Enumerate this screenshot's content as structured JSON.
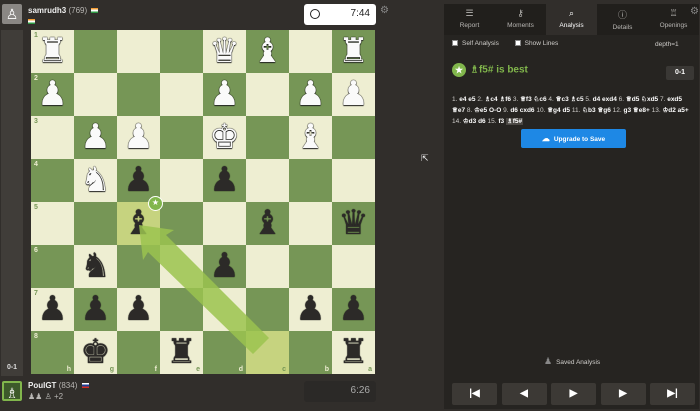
{
  "eval_bar": {
    "label": "0-1"
  },
  "top_player": {
    "avatar": "♙",
    "name": "samrudh3",
    "rating": "(769)"
  },
  "bottom_player": {
    "avatar": "♗",
    "name": "PoulGT",
    "rating": "(834)",
    "captured": "♟♟ ♙ +2"
  },
  "top_clock": {
    "icon": "clock-icon",
    "time": "7:44"
  },
  "bottom_clock": {
    "time": "6:26"
  },
  "board": {
    "ranks": [
      "1",
      "2",
      "3",
      "4",
      "5",
      "6",
      "7",
      "8"
    ],
    "files": [
      "h",
      "g",
      "f",
      "e",
      "d",
      "c",
      "b",
      "a"
    ],
    "colors": {
      "light": "#eeeed2",
      "dark": "#769656",
      "highlight": "#c6d37f",
      "arrow": "#9bc34f"
    },
    "pieces": [
      {
        "row": 0,
        "col": 0,
        "glyph": "♜",
        "side": "w"
      },
      {
        "row": 0,
        "col": 4,
        "glyph": "♛",
        "side": "w"
      },
      {
        "row": 0,
        "col": 5,
        "glyph": "♝",
        "side": "w"
      },
      {
        "row": 0,
        "col": 7,
        "glyph": "♜",
        "side": "w"
      },
      {
        "row": 1,
        "col": 0,
        "glyph": "♟",
        "side": "w"
      },
      {
        "row": 1,
        "col": 4,
        "glyph": "♟",
        "side": "w"
      },
      {
        "row": 1,
        "col": 6,
        "glyph": "♟",
        "side": "w"
      },
      {
        "row": 1,
        "col": 7,
        "glyph": "♟",
        "side": "w"
      },
      {
        "row": 2,
        "col": 1,
        "glyph": "♟",
        "side": "w"
      },
      {
        "row": 2,
        "col": 2,
        "glyph": "♟",
        "side": "w"
      },
      {
        "row": 2,
        "col": 4,
        "glyph": "♚",
        "side": "w"
      },
      {
        "row": 2,
        "col": 6,
        "glyph": "♝",
        "side": "w"
      },
      {
        "row": 3,
        "col": 1,
        "glyph": "♞",
        "side": "w"
      },
      {
        "row": 3,
        "col": 2,
        "glyph": "♟",
        "side": "b"
      },
      {
        "row": 3,
        "col": 4,
        "glyph": "♟",
        "side": "b"
      },
      {
        "row": 4,
        "col": 2,
        "glyph": "♝",
        "side": "b"
      },
      {
        "row": 4,
        "col": 5,
        "glyph": "♝",
        "side": "b"
      },
      {
        "row": 4,
        "col": 7,
        "glyph": "♛",
        "side": "b"
      },
      {
        "row": 5,
        "col": 1,
        "glyph": "♞",
        "side": "b"
      },
      {
        "row": 5,
        "col": 4,
        "glyph": "♟",
        "side": "b"
      },
      {
        "row": 6,
        "col": 0,
        "glyph": "♟",
        "side": "b"
      },
      {
        "row": 6,
        "col": 1,
        "glyph": "♟",
        "side": "b"
      },
      {
        "row": 6,
        "col": 2,
        "glyph": "♟",
        "side": "b"
      },
      {
        "row": 6,
        "col": 6,
        "glyph": "♟",
        "side": "b"
      },
      {
        "row": 6,
        "col": 7,
        "glyph": "♟",
        "side": "b"
      },
      {
        "row": 7,
        "col": 1,
        "glyph": "♚",
        "side": "b"
      },
      {
        "row": 7,
        "col": 3,
        "glyph": "♜",
        "side": "b"
      },
      {
        "row": 7,
        "col": 7,
        "glyph": "♜",
        "side": "b"
      }
    ],
    "highlighted_squares": [
      {
        "row": 4,
        "col": 2
      },
      {
        "row": 7,
        "col": 5
      }
    ],
    "best_move_badge": "★"
  },
  "tabs": [
    {
      "icon": "☰",
      "label": "Report"
    },
    {
      "icon": "⚷",
      "label": "Moments"
    },
    {
      "icon": "⌕",
      "label": "Analysis",
      "active": true
    },
    {
      "icon": "ⓘ",
      "label": "Details"
    },
    {
      "icon": "♖",
      "label": "Openings"
    }
  ],
  "options": {
    "self_analysis": "Self Analysis",
    "show_lines": "Show Lines",
    "depth": "depth=1"
  },
  "best_move": {
    "icon": "★",
    "text": "♗f5# is best",
    "score": "0-1"
  },
  "moves": [
    {
      "n": "1.",
      "w": "e4",
      "b": "e5"
    },
    {
      "n": "2.",
      "w": "♗c4",
      "b": "♗f6"
    },
    {
      "n": "3.",
      "w": "♕f3",
      "b": "♘c6"
    },
    {
      "n": "4.",
      "w": "♕c3",
      "b": "♗c5"
    },
    {
      "n": "5.",
      "w": "d4",
      "b": "exd4"
    },
    {
      "n": "6.",
      "w": "♕d5",
      "b": "♘xd5",
      "bc": "orange"
    },
    {
      "n": "7.",
      "w": "exd5",
      "b": "♕e7"
    },
    {
      "n": "8.",
      "w": "♔e5",
      "b": "O-O"
    },
    {
      "n": "9.",
      "w": "d6",
      "b": "cxd6",
      "bc": "orange"
    },
    {
      "n": "10.",
      "w": "♕g4",
      "b": "d5"
    },
    {
      "n": "11.",
      "w": "♘b3",
      "b": "♕g6"
    },
    {
      "n": "12.",
      "w": "g3",
      "b": "♕e8+"
    },
    {
      "n": "13.",
      "w": "♔d2",
      "b": "a5+"
    },
    {
      "n": "14.",
      "w": "♔d3",
      "b": "d6"
    },
    {
      "n": "15.",
      "w": "f3",
      "b": "♗f5#",
      "bc": "last"
    }
  ],
  "upgrade": {
    "icon": "☁",
    "label": "Upgrade to Save"
  },
  "saved": {
    "icon": "♟",
    "label": "Saved Analysis"
  },
  "nav": [
    {
      "name": "first-move-button",
      "icon": "|◀"
    },
    {
      "name": "prev-move-button",
      "icon": "◀"
    },
    {
      "name": "play-button",
      "icon": "▶"
    },
    {
      "name": "next-move-button",
      "icon": "▶"
    },
    {
      "name": "last-move-button",
      "icon": "▶|"
    }
  ]
}
